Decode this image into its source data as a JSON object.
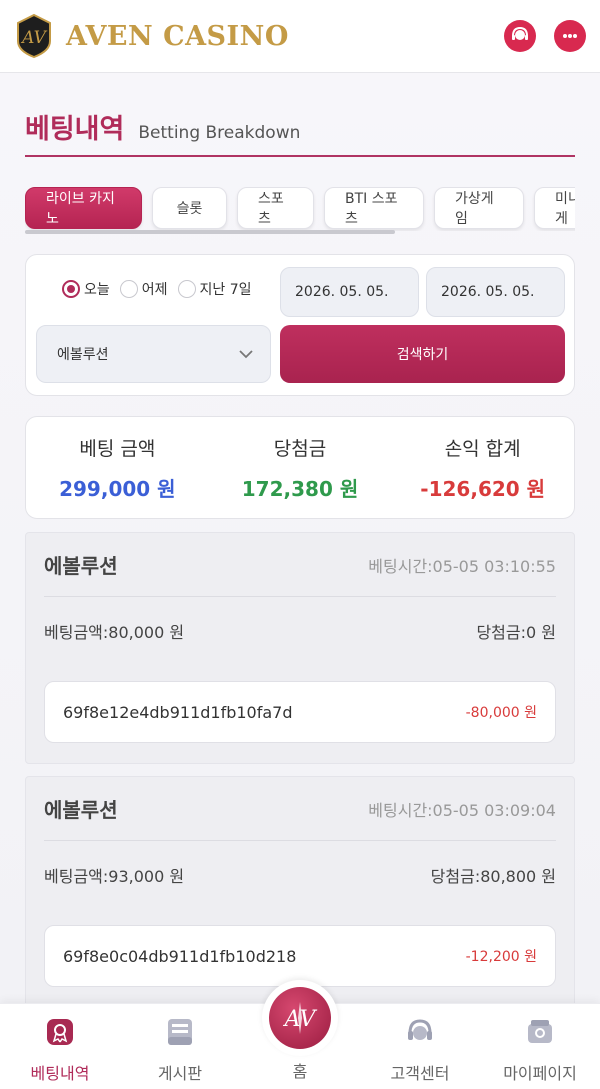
{
  "brand": {
    "name": "AVEN CASINO"
  },
  "page": {
    "title_ko": "베팅내역",
    "title_en": "Betting Breakdown"
  },
  "tabs": [
    {
      "label": "라이브 카지노",
      "active": true
    },
    {
      "label": "슬롯"
    },
    {
      "label": "스포츠"
    },
    {
      "label": "BTI 스포츠"
    },
    {
      "label": "가상게임"
    },
    {
      "label": "미니게"
    }
  ],
  "filter": {
    "ranges": [
      {
        "label": "오늘",
        "selected": true
      },
      {
        "label": "어제"
      },
      {
        "label": "지난 7일"
      }
    ],
    "date_from": "2026. 05. 05.",
    "date_to": "2026. 05. 05.",
    "provider": "에볼루션",
    "search_label": "검색하기"
  },
  "summary": {
    "bet_label": "베팅 금액",
    "bet_value": "299,000 원",
    "win_label": "당첨금",
    "win_value": "172,380 원",
    "pl_label": "손익 합계",
    "pl_value": "-126,620 원",
    "colors": {
      "bet": "#3b5fd6",
      "win": "#2f9a4c",
      "pl": "#d83b3b"
    }
  },
  "records": [
    {
      "provider": "에볼루션",
      "time": "베팅시간:05-05 03:10:55",
      "bet": "베팅금액:80,000 원",
      "win": "당첨금:0 원",
      "id": "69f8e12e4db911d1fb10fa7d",
      "pl": "-80,000 원"
    },
    {
      "provider": "에볼루션",
      "time": "베팅시간:05-05 03:09:04",
      "bet": "베팅금액:93,000 원",
      "win": "당첨금:80,800 원",
      "id": "69f8e0c04db911d1fb10d218",
      "pl": "-12,200 원"
    }
  ],
  "bottom_nav": {
    "bets": "베팅내역",
    "board": "게시판",
    "home": "홈",
    "support": "고객센터",
    "mypage": "마이페이지"
  },
  "accent": "#b02c5a"
}
